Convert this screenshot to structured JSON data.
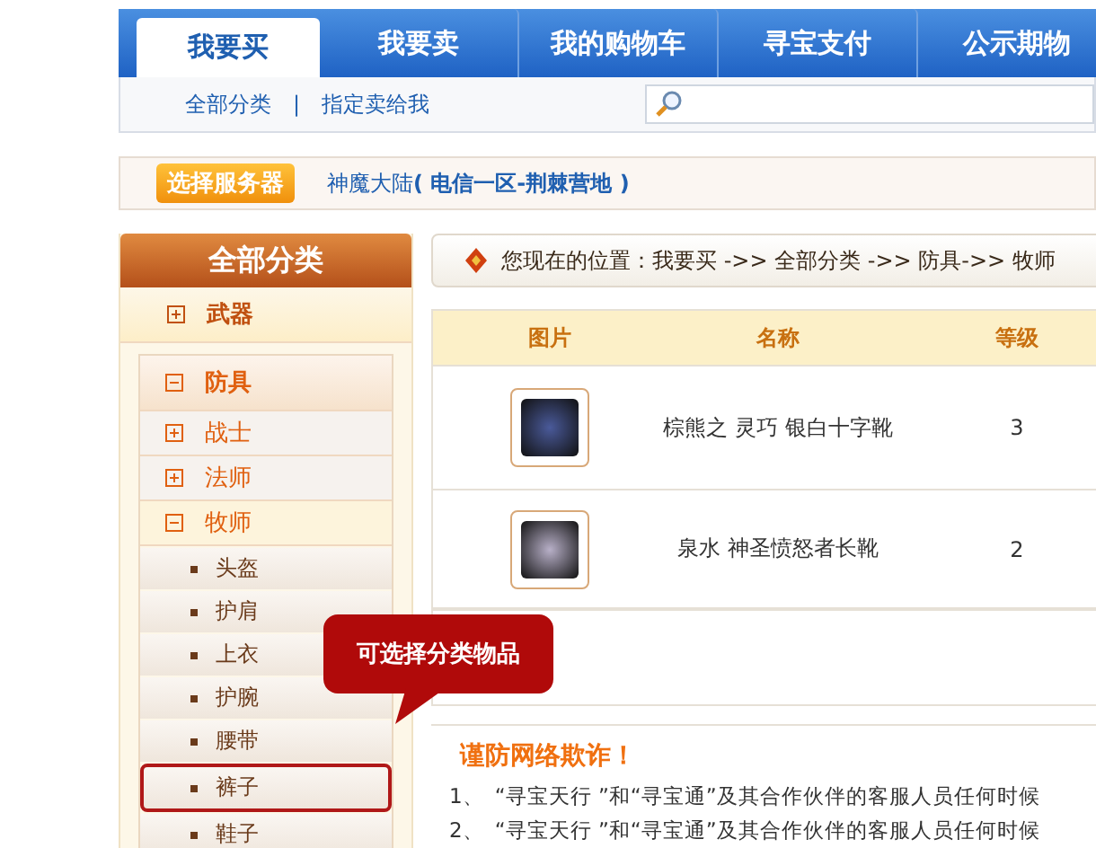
{
  "tabs": [
    {
      "label": "我要买",
      "selected": true
    },
    {
      "label": "我要卖",
      "selected": false
    },
    {
      "label": "我的购物车",
      "selected": false
    },
    {
      "label": "寻宝支付",
      "selected": false
    },
    {
      "label": "公示期物",
      "selected": false
    }
  ],
  "subnav": {
    "links": [
      "全部分类",
      "指定卖给我"
    ],
    "separator": "|"
  },
  "server": {
    "button": "选择服务器",
    "name": "神魔大陆",
    "zone": "( 电信一区-荆棘营地 )"
  },
  "sidebar": {
    "title": "全部分类",
    "categories": [
      {
        "label": "武器",
        "expanded": false
      },
      {
        "label": "防具",
        "expanded": true,
        "children": [
          {
            "label": "战士",
            "expanded": false
          },
          {
            "label": "法师",
            "expanded": false
          },
          {
            "label": "牧师",
            "expanded": true,
            "children": [
              {
                "label": "头盔",
                "selected": false
              },
              {
                "label": "护肩",
                "selected": false
              },
              {
                "label": "上衣",
                "selected": false
              },
              {
                "label": "护腕",
                "selected": false
              },
              {
                "label": "腰带",
                "selected": false
              },
              {
                "label": "裤子",
                "selected": true
              },
              {
                "label": "鞋子",
                "selected": false
              }
            ]
          }
        ]
      }
    ]
  },
  "callout": "可选择分类物品",
  "breadcrumb": "您现在的位置：我要买 ->> 全部分类 ->> 防具->> 牧师",
  "table": {
    "columns": [
      "图片",
      "名称",
      "等级"
    ],
    "rows": [
      {
        "name": "棕熊之 灵巧 银白十字靴",
        "level": "3"
      },
      {
        "name": "泉水 神圣愤怒者长靴",
        "level": "2"
      }
    ]
  },
  "warning": {
    "title": "谨防网络欺诈！",
    "items": [
      {
        "number": "1、",
        "text": "“寻宝天行 ”和“寻宝通”及其合作伙伴的客服人员任何时候"
      },
      {
        "number": "2、",
        "text": "“寻宝天行 ”和“寻宝通”及其合作伙伴的客服人员任何时候"
      }
    ]
  }
}
